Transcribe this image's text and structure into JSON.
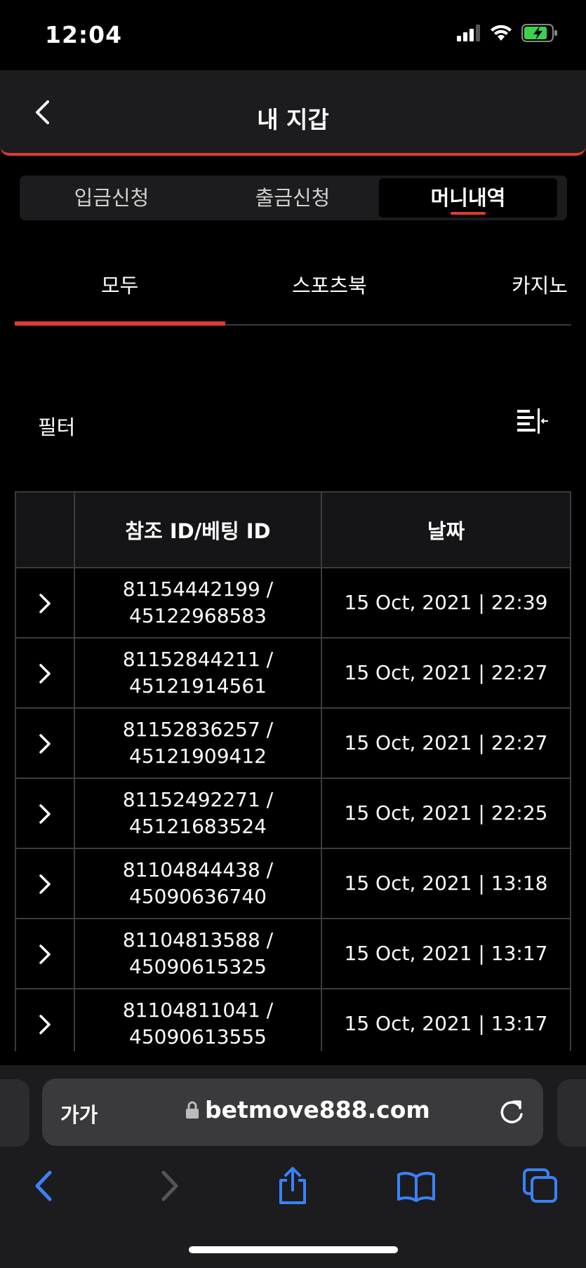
{
  "status_bar": {
    "time": "12:04"
  },
  "header": {
    "title": "내 지갑"
  },
  "segments": [
    {
      "label": "입금신청"
    },
    {
      "label": "출금신청"
    },
    {
      "label": "머니내역"
    }
  ],
  "tabs": [
    {
      "label": "모두"
    },
    {
      "label": "스포츠북"
    },
    {
      "label": "카지노"
    }
  ],
  "filter": {
    "label": "필터"
  },
  "table": {
    "headers": [
      "참조 ID/베팅 ID",
      "날짜"
    ],
    "rows": [
      {
        "ref": "81154442199 /",
        "bet": "45122968583",
        "date": "15 Oct, 2021 | 22:39"
      },
      {
        "ref": "81152844211 /",
        "bet": "45121914561",
        "date": "15 Oct, 2021 | 22:27"
      },
      {
        "ref": "81152836257 /",
        "bet": "45121909412",
        "date": "15 Oct, 2021 | 22:27"
      },
      {
        "ref": "81152492271 /",
        "bet": "45121683524",
        "date": "15 Oct, 2021 | 22:25"
      },
      {
        "ref": "81104844438 /",
        "bet": "45090636740",
        "date": "15 Oct, 2021 | 13:18"
      },
      {
        "ref": "81104813588 /",
        "bet": "45090615325",
        "date": "15 Oct, 2021 | 13:17"
      },
      {
        "ref": "81104811041 /",
        "bet": "45090613555",
        "date": "15 Oct, 2021 | 13:17"
      }
    ]
  },
  "browser": {
    "aa_label": "가가",
    "url": "betmove888.com"
  },
  "colors": {
    "accent": "#e23a32",
    "link": "#3a82f7"
  }
}
